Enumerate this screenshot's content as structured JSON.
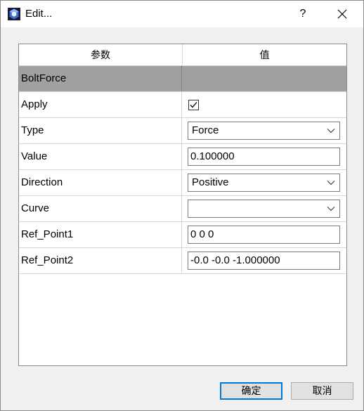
{
  "window": {
    "title": "Edit...",
    "help_label": "?",
    "icons": {
      "app": "app-logo-icon",
      "close": "close-icon"
    }
  },
  "table": {
    "headers": [
      "参数",
      "值"
    ],
    "group": {
      "label": "BoltForce"
    },
    "rows": [
      {
        "name": "Apply",
        "kind": "checkbox",
        "checked": true
      },
      {
        "name": "Type",
        "kind": "combo",
        "value": "Force"
      },
      {
        "name": "Value",
        "kind": "edit",
        "value": "0.100000"
      },
      {
        "name": "Direction",
        "kind": "combo",
        "value": "Positive"
      },
      {
        "name": "Curve",
        "kind": "combo",
        "value": ""
      },
      {
        "name": "Ref_Point1",
        "kind": "edit",
        "value": "0 0 0"
      },
      {
        "name": "Ref_Point2",
        "kind": "edit",
        "value": "-0.0 -0.0 -1.000000"
      }
    ]
  },
  "buttons": {
    "ok": "确定",
    "cancel": "取消"
  },
  "colors": {
    "group_row": "#a0a0a0",
    "accent": "#0078d7"
  }
}
